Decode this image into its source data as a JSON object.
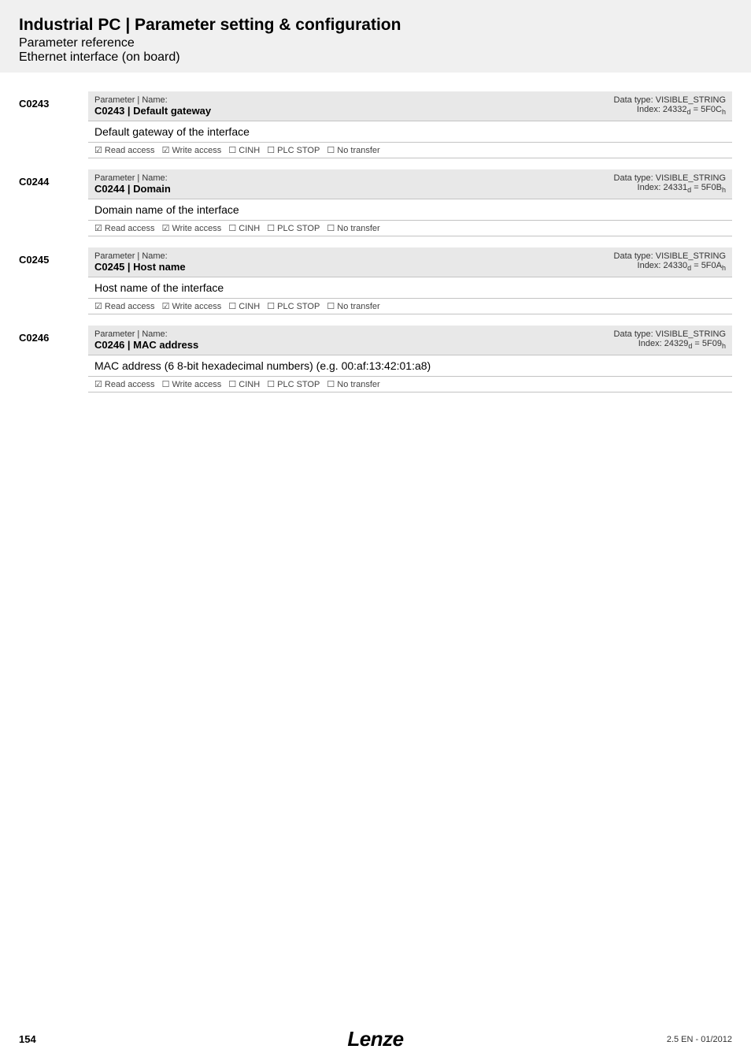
{
  "header": {
    "title": "Industrial PC | Parameter setting & configuration",
    "subtitle": "Parameter reference",
    "sub2": "Ethernet interface (on board)"
  },
  "params": [
    {
      "id": "C0243",
      "nameLabel": "Parameter | Name:",
      "name": "C0243 | Default gateway",
      "dataType": "Data type: VISIBLE_STRING",
      "index_pre": "Index: 24332",
      "index_mid": " = 5F0C",
      "desc": "Default gateway of the interface",
      "access": {
        "read": "☑ Read access",
        "write": "☑ Write access",
        "cinh": "☐ CINH",
        "plc": "☐ PLC STOP",
        "notx": "☐ No transfer"
      }
    },
    {
      "id": "C0244",
      "nameLabel": "Parameter | Name:",
      "name": "C0244 | Domain",
      "dataType": "Data type: VISIBLE_STRING",
      "index_pre": "Index: 24331",
      "index_mid": " = 5F0B",
      "desc": "Domain name of the interface",
      "access": {
        "read": "☑ Read access",
        "write": "☑ Write access",
        "cinh": "☐ CINH",
        "plc": "☐ PLC STOP",
        "notx": "☐ No transfer"
      }
    },
    {
      "id": "C0245",
      "nameLabel": "Parameter | Name:",
      "name": "C0245 | Host name",
      "dataType": "Data type: VISIBLE_STRING",
      "index_pre": "Index: 24330",
      "index_mid": " = 5F0A",
      "desc": "Host name of the interface",
      "access": {
        "read": "☑ Read access",
        "write": "☑ Write access",
        "cinh": "☐ CINH",
        "plc": "☐ PLC STOP",
        "notx": "☐ No transfer"
      }
    },
    {
      "id": "C0246",
      "nameLabel": "Parameter | Name:",
      "name": "C0246 | MAC address",
      "dataType": "Data type: VISIBLE_STRING",
      "index_pre": "Index: 24329",
      "index_mid": " = 5F09",
      "desc": "MAC address (6 8-bit hexadecimal numbers) (e.g. 00:af:13:42:01:a8)",
      "access": {
        "read": "☑ Read access",
        "write": "☐ Write access",
        "cinh": "☐ CINH",
        "plc": "☐ PLC STOP",
        "notx": "☐ No transfer"
      }
    }
  ],
  "footer": {
    "page": "154",
    "brand": "Lenze",
    "version": "2.5 EN - 01/2012"
  },
  "subs": {
    "d": "d",
    "h": "h"
  }
}
